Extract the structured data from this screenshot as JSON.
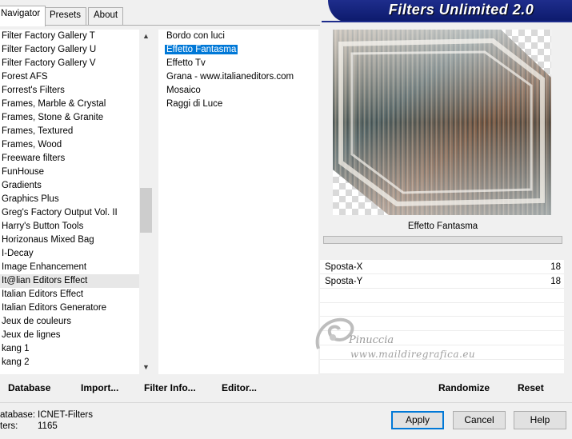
{
  "tabs": [
    "Navigator",
    "Presets",
    "About"
  ],
  "banner_title": "Filters Unlimited 2.0",
  "categories": [
    "Filter Factory Gallery T",
    "Filter Factory Gallery U",
    "Filter Factory Gallery V",
    "Forest AFS",
    "Forrest's Filters",
    "Frames, Marble & Crystal",
    "Frames, Stone & Granite",
    "Frames, Textured",
    "Frames, Wood",
    "Freeware filters",
    "FunHouse",
    "Gradients",
    "Graphics Plus",
    "Greg's Factory Output Vol. II",
    "Harry's Button Tools",
    "Horizonaus Mixed Bag",
    "I-Decay",
    "Image Enhancement",
    "It@lian Editors Effect",
    "Italian Editors Effect",
    "Italian Editors Generatore",
    "Jeux de couleurs",
    "Jeux de lignes",
    "kang 1",
    "kang 2"
  ],
  "selected_category_index": 18,
  "filters": [
    "Bordo con luci",
    "Effetto Fantasma",
    "Effetto Tv",
    "Grana - www.italianeditors.com",
    "Mosaico",
    "Raggi di Luce"
  ],
  "selected_filter_index": 1,
  "filter_name": "Effetto Fantasma",
  "params": [
    {
      "name": "Sposta-X",
      "value": "18"
    },
    {
      "name": "Sposta-Y",
      "value": "18"
    }
  ],
  "watermark": {
    "line1": "Pinuccia",
    "line2": "www.maildiregrafica.eu"
  },
  "buttons": {
    "database": "Database",
    "import": "Import...",
    "filter_info": "Filter Info...",
    "editor": "Editor...",
    "randomize": "Randomize",
    "reset": "Reset",
    "apply": "Apply",
    "cancel": "Cancel",
    "help": "Help"
  },
  "status": {
    "database_label": "atabase:",
    "database_value": "ICNET-Filters",
    "filters_label": "ters:",
    "filters_value": "1165"
  },
  "colors": {
    "accent": "#0078d7",
    "banner": "#0c1a6c"
  },
  "icons": {
    "scroll_up": "chevron-up-icon",
    "scroll_down": "chevron-down-icon"
  }
}
